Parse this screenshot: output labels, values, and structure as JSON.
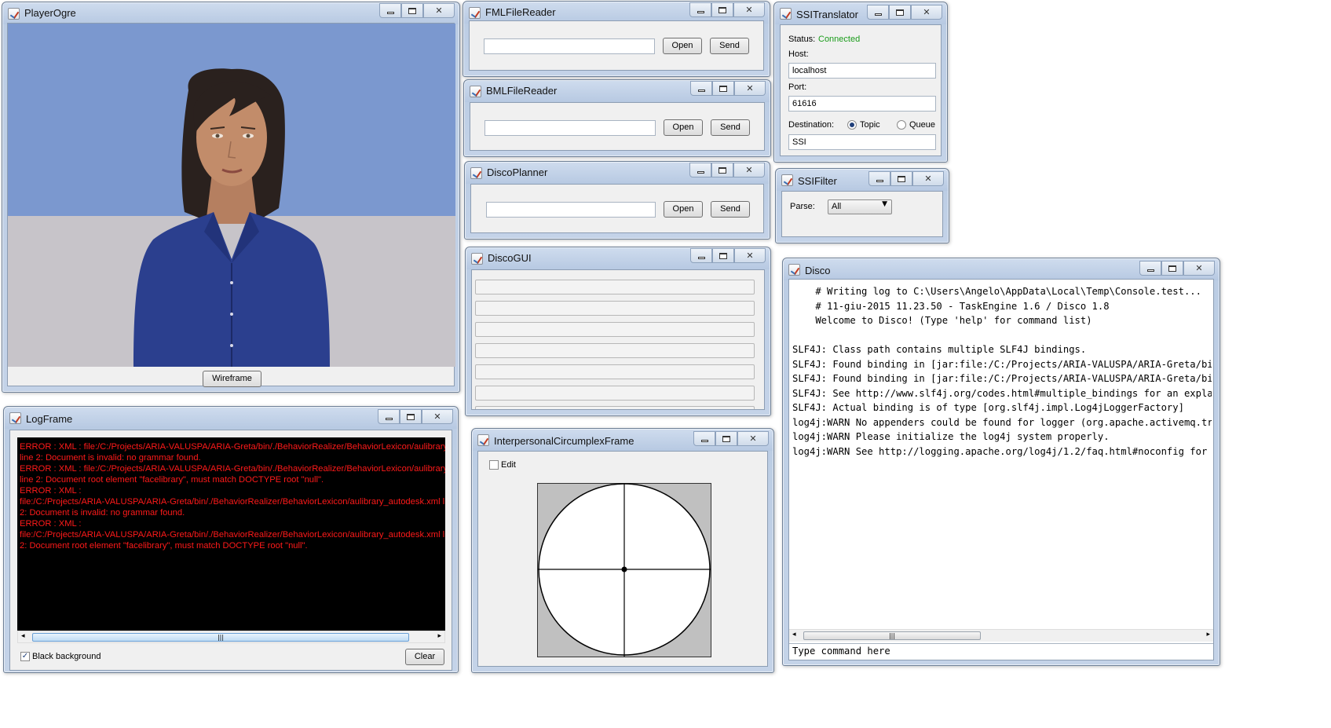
{
  "windows": {
    "player_ogre": {
      "title": "PlayerOgre",
      "wireframe_label": "Wireframe"
    },
    "fml_reader": {
      "title": "FMLFileReader",
      "open_label": "Open",
      "send_label": "Send",
      "input_value": ""
    },
    "bml_reader": {
      "title": "BMLFileReader",
      "open_label": "Open",
      "send_label": "Send",
      "input_value": ""
    },
    "disco_planner": {
      "title": "DiscoPlanner",
      "open_label": "Open",
      "send_label": "Send",
      "input_value": ""
    },
    "disco_gui": {
      "title": "DiscoGUI"
    },
    "ssi_translator": {
      "title": "SSITranslator",
      "status_label": "Status:",
      "status_value": "Connected",
      "host_label": "Host:",
      "host_value": "localhost",
      "port_label": "Port:",
      "port_value": "61616",
      "destination_label": "Destination:",
      "topic_label": "Topic",
      "queue_label": "Queue",
      "destination_selected": "Topic",
      "destination_value": "SSI"
    },
    "ssi_filter": {
      "title": "SSIFilter",
      "parse_label": "Parse:",
      "parse_value": "All"
    },
    "log_frame": {
      "title": "LogFrame",
      "lines": [
        "ERROR : XML : file:/C:/Projects/ARIA-VALUSPA/ARIA-Greta/bin/./BehaviorRealizer/BehaviorLexicon/aulibrary.xml",
        "line 2: Document is invalid: no grammar found.",
        "ERROR : XML : file:/C:/Projects/ARIA-VALUSPA/ARIA-Greta/bin/./BehaviorRealizer/BehaviorLexicon/aulibrary.xml",
        "line 2: Document root element \"facelibrary\", must match DOCTYPE root \"null\".",
        "ERROR : XML :",
        "file:/C:/Projects/ARIA-VALUSPA/ARIA-Greta/bin/./BehaviorRealizer/BehaviorLexicon/aulibrary_autodesk.xml line",
        "2: Document is invalid: no grammar found.",
        "ERROR : XML :",
        "file:/C:/Projects/ARIA-VALUSPA/ARIA-Greta/bin/./BehaviorRealizer/BehaviorLexicon/aulibrary_autodesk.xml line",
        "2: Document root element \"facelibrary\", must match DOCTYPE root \"null\"."
      ],
      "black_background_label": "Black background",
      "clear_label": "Clear",
      "error_color": "#ff1a1a"
    },
    "interpersonal": {
      "title": "InterpersonalCircumplexFrame",
      "edit_label": "Edit"
    },
    "disco": {
      "title": "Disco",
      "console_lines": [
        "    # Writing log to C:\\Users\\Angelo\\AppData\\Local\\Temp\\Console.test...",
        "    # 11-giu-2015 11.23.50 - TaskEngine 1.6 / Disco 1.8",
        "    Welcome to Disco! (Type 'help' for command list)",
        "",
        "SLF4J: Class path contains multiple SLF4J bindings.",
        "SLF4J: Found binding in [jar:file:/C:/Projects/ARIA-VALUSPA/ARIA-Greta/bi",
        "SLF4J: Found binding in [jar:file:/C:/Projects/ARIA-VALUSPA/ARIA-Greta/bi",
        "SLF4J: See http://www.slf4j.org/codes.html#multiple_bindings for an expla",
        "SLF4J: Actual binding is of type [org.slf4j.impl.Log4jLoggerFactory]",
        "log4j:WARN No appenders could be found for logger (org.apache.activemq.tr",
        "log4j:WARN Please initialize the log4j system properly.",
        "log4j:WARN See http://logging.apache.org/log4j/1.2/faq.html#noconfig for"
      ],
      "command_placeholder": "Type command here"
    }
  },
  "colors": {
    "status_connected": "#1a9c1a",
    "sky": "#7b98cf",
    "floor": "#c7c4c9",
    "shirt": "#2b3f8e"
  },
  "icons": {
    "java_window_icon": "java-cup-icon",
    "dropdown": "chevron-down-icon"
  }
}
